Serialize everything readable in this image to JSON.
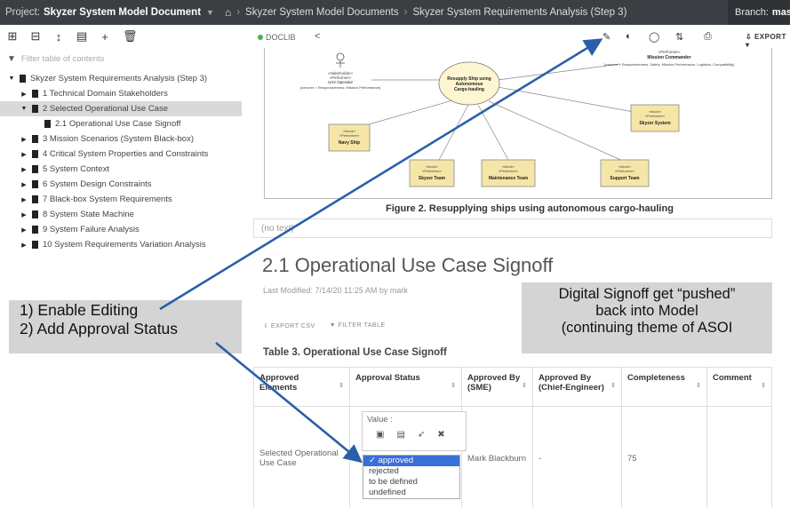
{
  "topbar": {
    "project_label": "Project:",
    "project_name": "Skyzer System Model Document",
    "crumb1": "Skyzer System Model Documents",
    "crumb2": "Skyzer System Requirements Analysis (Step 3)",
    "branch_label": "Branch:",
    "branch_value": "mas"
  },
  "sidebar": {
    "filter_placeholder": "Filter table of contents",
    "root": "Skyzer System Requirements Analysis (Step 3)",
    "items": [
      {
        "label": "1 Technical Domain Stakeholders"
      },
      {
        "label": "2 Selected Operational Use Case"
      },
      {
        "label": "2.1 Operational Use Case Signoff"
      },
      {
        "label": "3 Mission Scenarios (System Black-box)"
      },
      {
        "label": "4 Critical System Properties and Constraints"
      },
      {
        "label": "5 System Context"
      },
      {
        "label": "6 System Design Constraints"
      },
      {
        "label": "7 Black-box System Requirements"
      },
      {
        "label": "8 System State Machine"
      },
      {
        "label": "9 System Failure Analysis"
      },
      {
        "label": "10 System Requirements Variation Analysis"
      }
    ]
  },
  "toolbar": {
    "docid": "DOCLIB",
    "export_label": "EXPORT"
  },
  "diagram": {
    "commander_stereo": "«Performer»",
    "commander_name": "Mission Commander",
    "commander_concerns": "[concern = Responsiveness, Safety, Mission Performance, Logistics, Compatibility]",
    "uav_stereo1": "«stakeholder»",
    "uav_stereo2": "«Performer»",
    "uav_name": "UAV Operator",
    "uav_concerns": "[concern = Responsiveness, Mission Performance]",
    "usecase": "Resupply Ship using Autonomous Cargo-hauling",
    "block_stereo": "«block»",
    "perf_stereo": "«Performer»",
    "navy": "Navy Ship",
    "skyzer_system": "Skyzer System",
    "skyzer_team": "Skyzer Team",
    "maintenance_team": "Maintenance Team",
    "support_team": "Support Team"
  },
  "figure_caption": "Figure 2. Resupplying ships using autonomous cargo-hauling",
  "no_text": "(no text)",
  "section": {
    "title": "2.1 Operational Use Case Signoff",
    "last_modified": "Last Modified: 7/14/20 11:25 AM by mark",
    "export_csv": "EXPORT CSV",
    "filter_table": "FILTER TABLE",
    "table_caption": "Table 3. Operational Use Case Signoff"
  },
  "table": {
    "headers": [
      "Approved Elements",
      "Approval Status",
      "Approved By (SME)",
      "Approved By (Chief-Engineer)",
      "Completeness",
      "Comment"
    ],
    "row": {
      "element": "Selected Operational Use Case",
      "approved_by_sme": "Mark Blackburn",
      "approved_by_chief": "-",
      "completeness": "75",
      "comment": ""
    }
  },
  "editor": {
    "value_label": "Value :",
    "options": [
      "✓ approved",
      "rejected",
      "to be defined",
      "undefined"
    ]
  },
  "annotations": {
    "left_line1": "1) Enable Editing",
    "left_line2": "2) Add Approval Status",
    "right_line1": "Digital Signoff get “pushed”",
    "right_line2": "back into Model",
    "right_line3": "(continuing theme of ASOI"
  },
  "colors": {
    "arrow": "#2b5fa8",
    "block_fill": "#f5e6a8",
    "usecase_fill": "#fdf6d0",
    "dropdown_selected": "#3a6fd8"
  }
}
